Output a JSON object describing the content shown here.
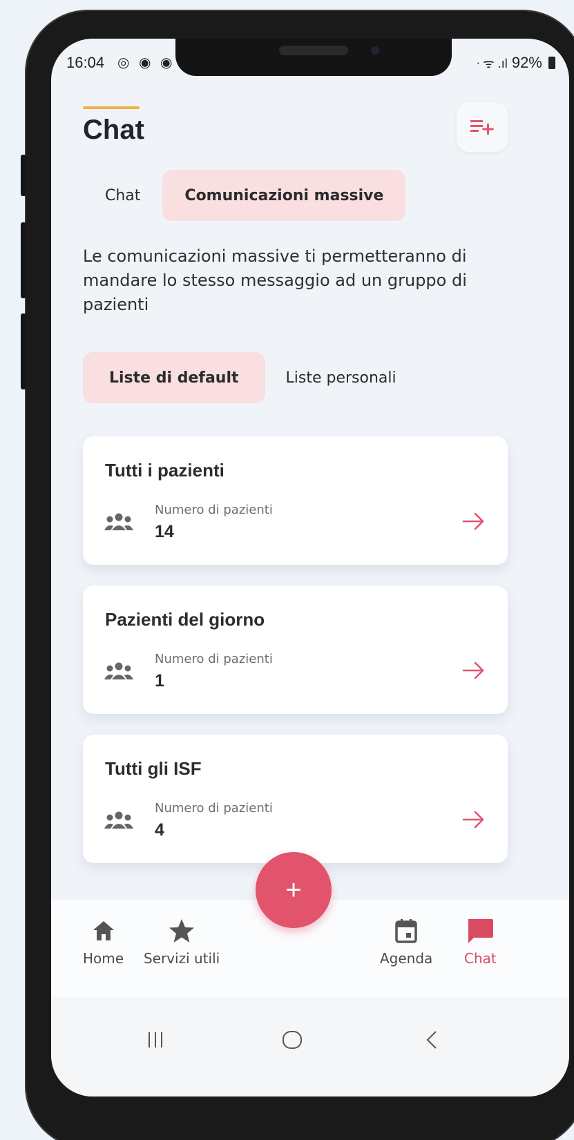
{
  "status_bar": {
    "time": "16:04",
    "left_icons": "◎ ◉ ◉",
    "right_icons": "ᐧ ᯤ .ıl",
    "battery": "92%"
  },
  "header": {
    "title": "Chat",
    "action_icon": "playlist-add-icon"
  },
  "tabs": [
    {
      "label": "Chat",
      "active": false
    },
    {
      "label": "Comunicazioni massive",
      "active": true
    }
  ],
  "description": "Le comunicazioni massive ti permetteranno di mandare lo stesso messaggio ad un gruppo di pazienti",
  "subtabs": [
    {
      "label": "Liste di default",
      "active": true
    },
    {
      "label": "Liste personali",
      "active": false
    }
  ],
  "lists": [
    {
      "title": "Tutti i pazienti",
      "label": "Numero di pazienti",
      "count": "14"
    },
    {
      "title": "Pazienti del giorno",
      "label": "Numero di pazienti",
      "count": "1"
    },
    {
      "title": "Tutti gli ISF",
      "label": "Numero di pazienti",
      "count": "4"
    }
  ],
  "fab": {
    "label": "+"
  },
  "bottom_nav": [
    {
      "label": "Home",
      "icon": "home-icon",
      "active": false
    },
    {
      "label": "Servizi utili",
      "icon": "star-icon",
      "active": false
    },
    {
      "label": "Agenda",
      "icon": "calendar-icon",
      "active": false
    },
    {
      "label": "Chat",
      "icon": "chat-icon",
      "active": true
    }
  ],
  "colors": {
    "accent": "#e2536c",
    "tab_active_bg": "#f9dfe0",
    "title_accent": "#f2b245",
    "background": "#f0f4f9"
  }
}
